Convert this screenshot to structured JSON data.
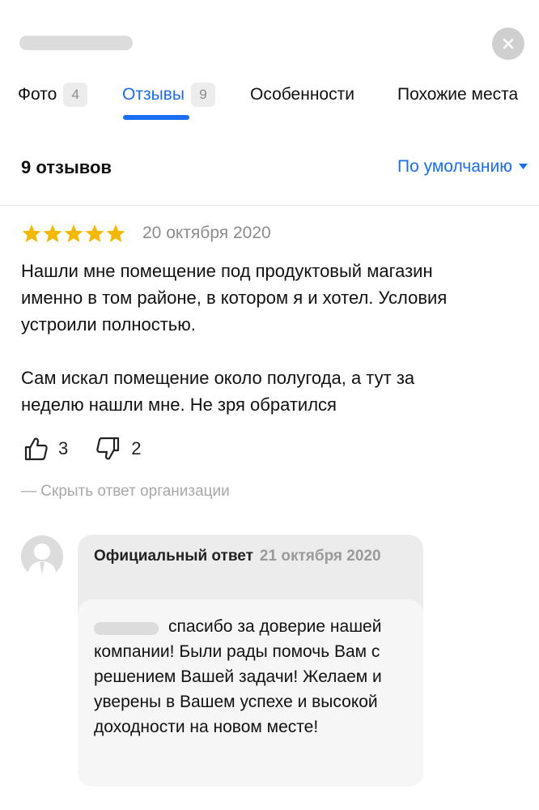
{
  "tabs": [
    {
      "label": "Фото",
      "count": "4"
    },
    {
      "label": "Отзывы",
      "count": "9"
    },
    {
      "label": "Особенности"
    },
    {
      "label": "Похожие места"
    }
  ],
  "reviews": {
    "count_label": "9 отзывов",
    "sort_label": "По умолчанию"
  },
  "review": {
    "rating": 5,
    "date": "20 октября 2020",
    "text": "Нашли мне помещение под продуктовый магазин\nименно в том районе, в котором я и хотел. Условия\nустроили полностью.\n\nСам искал помещение около полугода, а тут за\nнеделю нашли мне. Не зря обратился",
    "likes": "3",
    "dislikes": "2",
    "hide_answer_label": "— Скрыть ответ организации"
  },
  "answer": {
    "title": "Официальный ответ",
    "date": "21 октября 2020",
    "text": "спасибо за доверие нашей компании! Были рады помочь Вам с решением Вашей задачи! Желаем и уверены в Вашем успехе и высокой доходности на новом месте!"
  },
  "colors": {
    "accent": "#1a6ef0",
    "star": "#f5b800",
    "muted": "#8c8c8c"
  },
  "icons": {
    "close": "close-icon",
    "star": "star-icon",
    "like": "thumbs-up-icon",
    "dislike": "thumbs-down-icon",
    "avatar": "user-avatar-icon",
    "sort": "caret-down-icon"
  }
}
